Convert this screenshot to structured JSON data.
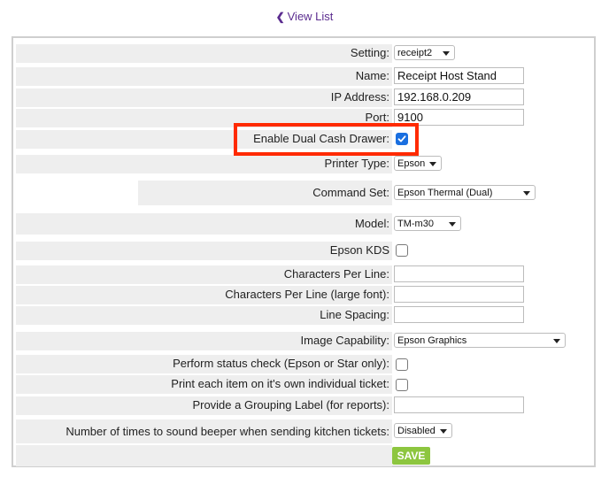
{
  "nav": {
    "back_label": "View List"
  },
  "fields": {
    "setting": {
      "label": "Setting:",
      "value": "receipt2"
    },
    "name": {
      "label": "Name:",
      "value": "Receipt Host Stand"
    },
    "ip": {
      "label": "IP Address:",
      "value": "192.168.0.209"
    },
    "port": {
      "label": "Port:",
      "value": "9100"
    },
    "dual_drawer": {
      "label": "Enable Dual Cash Drawer:",
      "checked": true
    },
    "printer_type": {
      "label": "Printer Type:",
      "value": "Epson"
    },
    "command_set": {
      "label": "Command Set:",
      "value": "Epson Thermal (Dual)"
    },
    "model": {
      "label": "Model:",
      "value": "TM-m30"
    },
    "epson_kds": {
      "label": "Epson KDS",
      "checked": false
    },
    "chars_per_line": {
      "label": "Characters Per Line:",
      "value": ""
    },
    "chars_per_line_large": {
      "label": "Characters Per Line (large font):",
      "value": ""
    },
    "line_spacing": {
      "label": "Line Spacing:",
      "value": ""
    },
    "image_capability": {
      "label": "Image Capability:",
      "value": "Epson Graphics"
    },
    "status_check": {
      "label": "Perform status check (Epson or Star only):",
      "checked": false
    },
    "individual_ticket": {
      "label": "Print each item on it's own individual ticket:",
      "checked": false
    },
    "grouping_label": {
      "label": "Provide a Grouping Label (for reports):",
      "value": ""
    },
    "beeper": {
      "label": "Number of times to sound beeper when sending kitchen tickets:",
      "value": "Disabled"
    }
  },
  "save_label": "SAVE",
  "colors": {
    "accent_link": "#5b2c8f",
    "save_button": "#8dc63f",
    "highlight_box": "#ff2a00",
    "checkbox_checked": "#1a6fe0"
  }
}
